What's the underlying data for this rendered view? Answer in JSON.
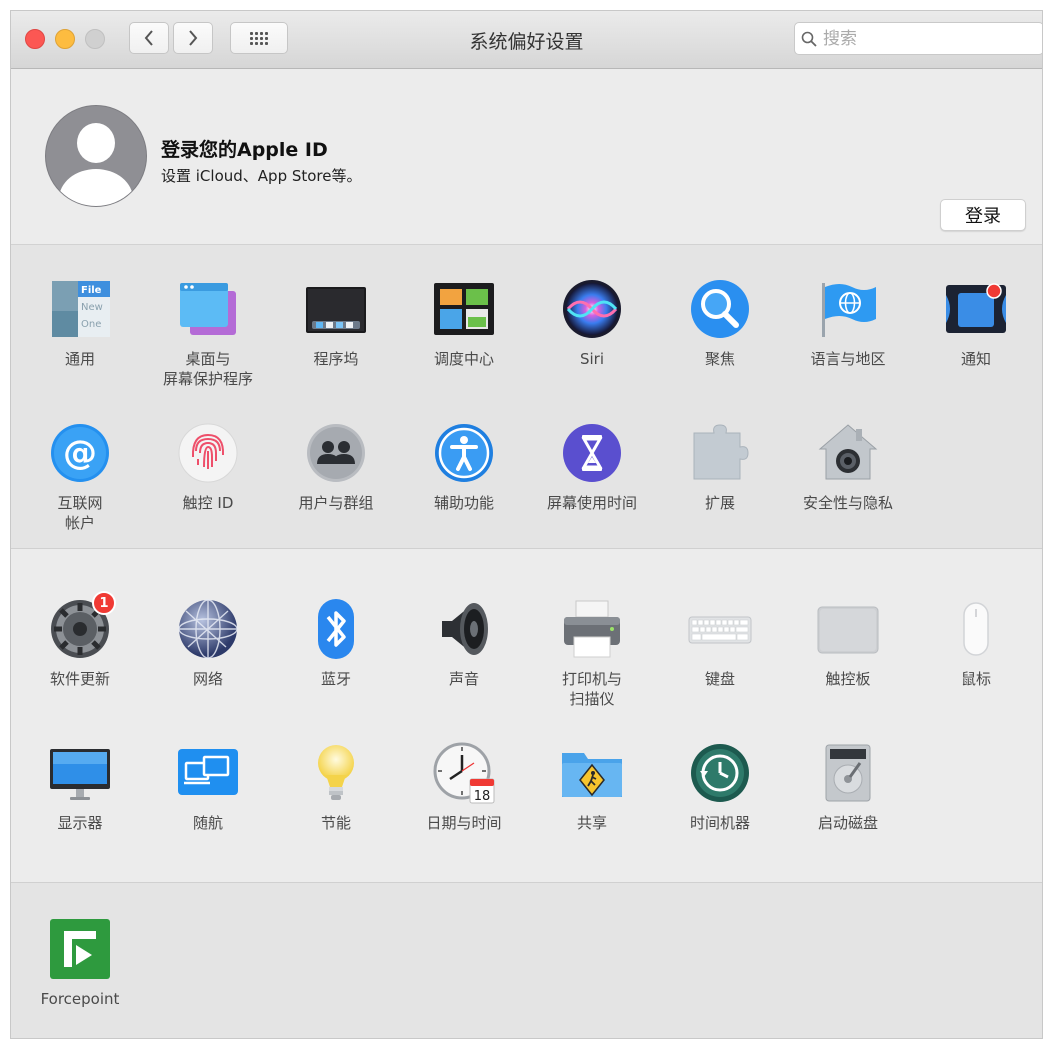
{
  "window": {
    "title": "系统偏好设置"
  },
  "search": {
    "placeholder": "搜索"
  },
  "account": {
    "title": "登录您的Apple ID",
    "subtitle": "设置 iCloud、App Store等。",
    "signin_label": "登录"
  },
  "section1": [
    {
      "label": "通用",
      "icon": "general-icon"
    },
    {
      "label": "桌面与\n屏幕保护程序",
      "icon": "desktop-screensaver-icon"
    },
    {
      "label": "程序坞",
      "icon": "dock-icon"
    },
    {
      "label": "调度中心",
      "icon": "mission-control-icon"
    },
    {
      "label": "Siri",
      "icon": "siri-icon"
    },
    {
      "label": "聚焦",
      "icon": "spotlight-icon"
    },
    {
      "label": "语言与地区",
      "icon": "language-region-icon"
    },
    {
      "label": "通知",
      "icon": "notifications-icon"
    },
    {
      "label": "互联网\n帐户",
      "icon": "internet-accounts-icon"
    },
    {
      "label": "触控 ID",
      "icon": "touch-id-icon"
    },
    {
      "label": "用户与群组",
      "icon": "users-groups-icon"
    },
    {
      "label": "辅助功能",
      "icon": "accessibility-icon"
    },
    {
      "label": "屏幕使用时间",
      "icon": "screen-time-icon"
    },
    {
      "label": "扩展",
      "icon": "extensions-icon"
    },
    {
      "label": "安全性与隐私",
      "icon": "security-privacy-icon"
    }
  ],
  "section2": [
    {
      "label": "软件更新",
      "icon": "software-update-icon",
      "badge": "1"
    },
    {
      "label": "网络",
      "icon": "network-icon"
    },
    {
      "label": "蓝牙",
      "icon": "bluetooth-icon"
    },
    {
      "label": "声音",
      "icon": "sound-icon"
    },
    {
      "label": "打印机与\n扫描仪",
      "icon": "printers-scanners-icon"
    },
    {
      "label": "键盘",
      "icon": "keyboard-icon"
    },
    {
      "label": "触控板",
      "icon": "trackpad-icon"
    },
    {
      "label": "鼠标",
      "icon": "mouse-icon"
    },
    {
      "label": "显示器",
      "icon": "displays-icon"
    },
    {
      "label": "随航",
      "icon": "sidecar-icon"
    },
    {
      "label": "节能",
      "icon": "energy-saver-icon"
    },
    {
      "label": "日期与时间",
      "icon": "date-time-icon",
      "date_badge": "18"
    },
    {
      "label": "共享",
      "icon": "sharing-icon"
    },
    {
      "label": "时间机器",
      "icon": "time-machine-icon"
    },
    {
      "label": "启动磁盘",
      "icon": "startup-disk-icon"
    }
  ],
  "section3": [
    {
      "label": "Forcepoint",
      "icon": "forcepoint-icon"
    }
  ],
  "general_icon_text": [
    "File",
    "New",
    "One"
  ]
}
